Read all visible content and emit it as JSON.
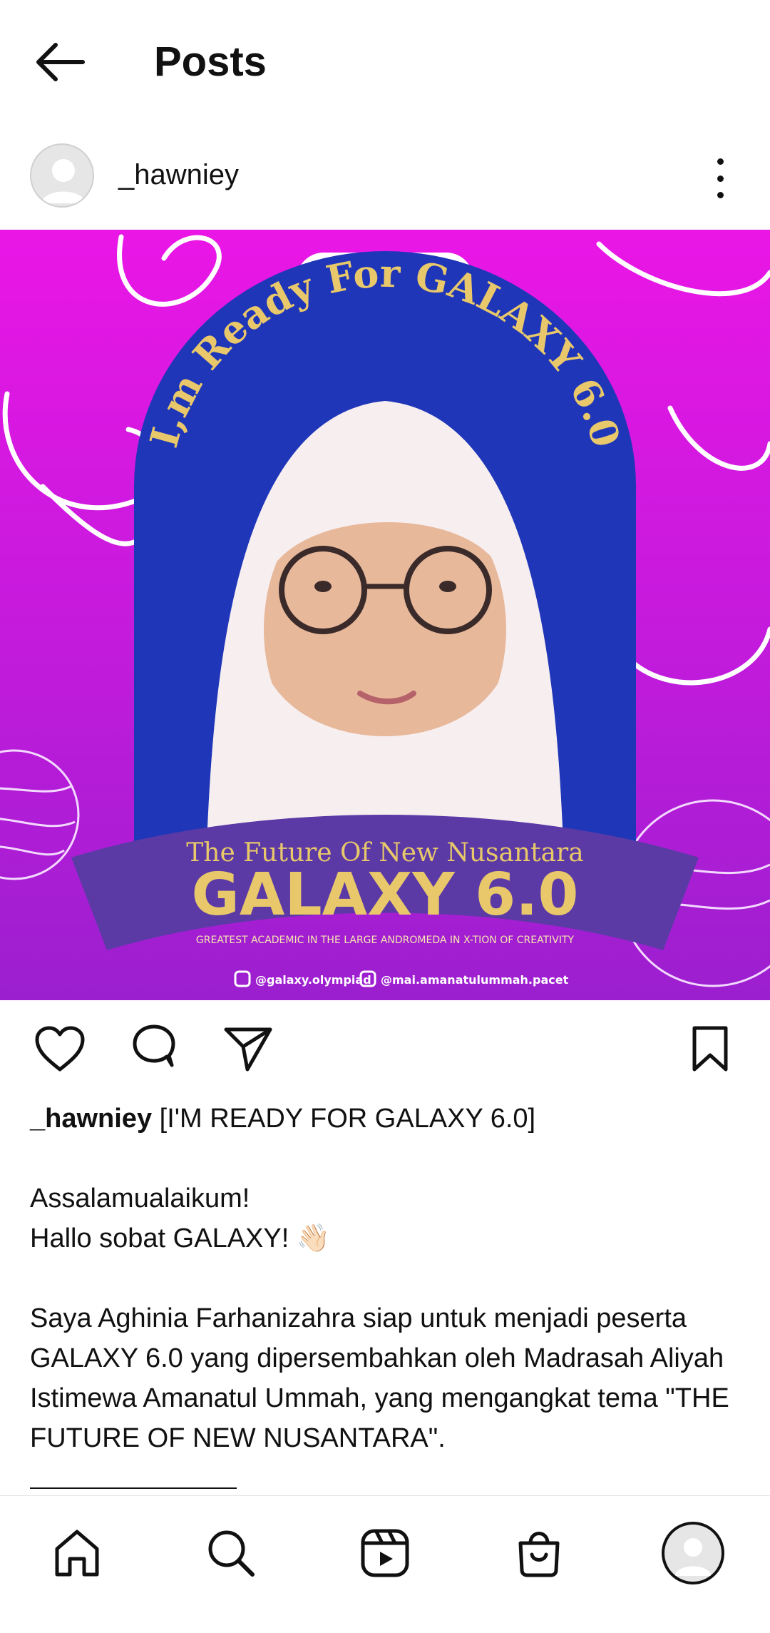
{
  "header": {
    "title": "Posts",
    "back_icon": "arrow-left-icon"
  },
  "post": {
    "username": "_hawniey",
    "image": {
      "arch_text": "I,m Ready For GALAXY 6.0",
      "ribbon_subtitle": "The Future Of New Nusantara",
      "ribbon_title": "GALAXY 6.0",
      "ribbon_tagline": "GREATEST ACADEMIC IN THE LARGE ANDROMEDA IN X-TION OF CREATIVITY",
      "handle_1": "@galaxy.olympiad",
      "handle_2": "@mai.amanatulummah.pacet",
      "colors": {
        "bg_top": "#e619e6",
        "bg_bottom": "#9b1fcf",
        "arch": "#1f36b8",
        "ribbon": "#5b3aa6",
        "gold": "#e8c86a"
      }
    },
    "caption": {
      "username": "_hawniey",
      "headline": "[I'M READY FOR GALAXY 6.0]",
      "line1": "Assalamualaikum!",
      "line2": "Hallo sobat GALAXY! 👋🏻",
      "para": "Saya Aghinia Farhanizahra siap untuk menjadi peserta GALAXY 6.0 yang dipersembahkan oleh Madrasah Aliyah Istimewa Amanatul Ummah, yang mengangkat tema \"THE FUTURE OF NEW NUSANTARA\"."
    }
  },
  "actions": [
    "heart-icon",
    "comment-icon",
    "share-icon",
    "bookmark-icon"
  ],
  "bottom_nav": [
    "home-icon",
    "search-icon",
    "reels-icon",
    "shop-icon",
    "profile-avatar"
  ]
}
